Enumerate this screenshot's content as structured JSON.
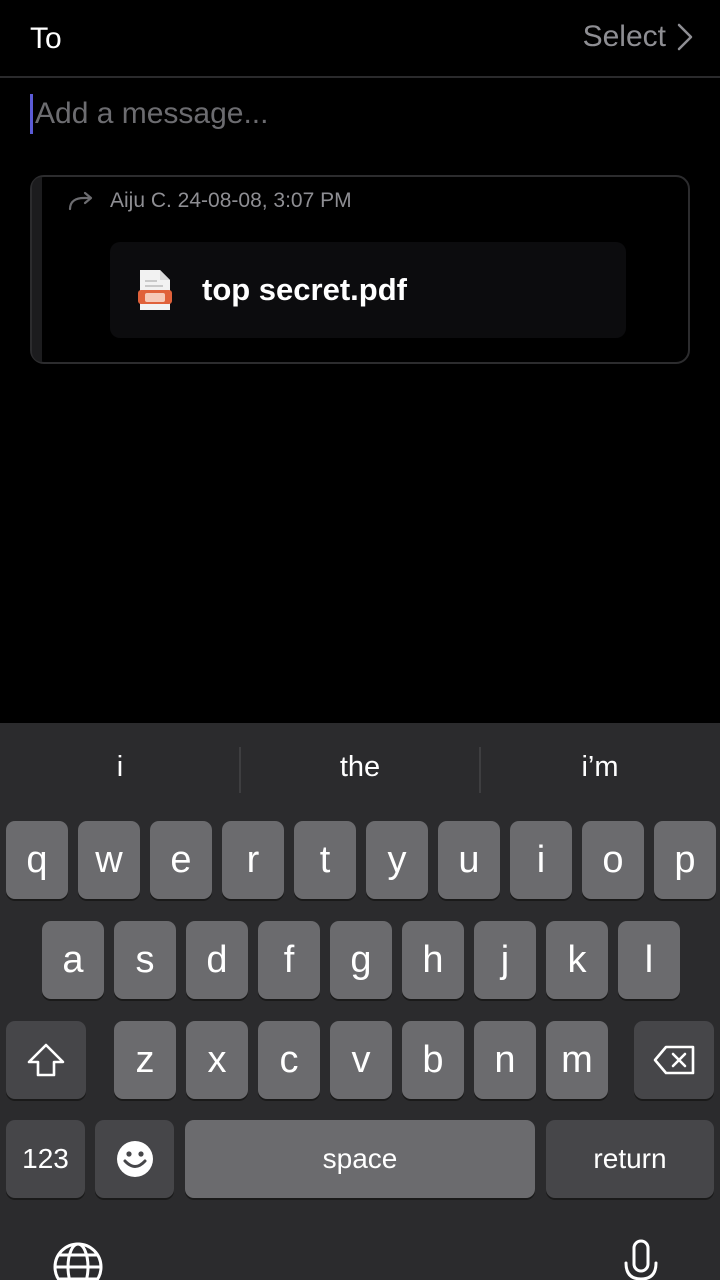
{
  "header": {
    "to_label": "To",
    "select_label": "Select"
  },
  "composer": {
    "placeholder": "Add a message..."
  },
  "forwarded": {
    "meta": "Aiju C. 24-08-08, 3:07 PM",
    "file_name": "top secret.pdf",
    "file_icon": "pdf-file-icon"
  },
  "keyboard": {
    "suggestions": [
      "i",
      "the",
      "i’m"
    ],
    "row1": [
      "q",
      "w",
      "e",
      "r",
      "t",
      "y",
      "u",
      "i",
      "o",
      "p"
    ],
    "row2": [
      "a",
      "s",
      "d",
      "f",
      "g",
      "h",
      "j",
      "k",
      "l"
    ],
    "row3": [
      "z",
      "x",
      "c",
      "v",
      "b",
      "n",
      "m"
    ],
    "numbers_label": "123",
    "space_label": "space",
    "return_label": "return",
    "shift_icon": "shift-icon",
    "delete_icon": "backspace-icon",
    "emoji_icon": "emoji-icon",
    "globe_icon": "globe-icon",
    "mic_icon": "microphone-icon"
  },
  "colors": {
    "background": "#000000",
    "keyboard_bg": "#2b2b2d",
    "key": "#6b6b6e",
    "key_dark": "#464649",
    "muted_text": "#8e8e93",
    "caret": "#5b5bd6",
    "pdf_accent": "#e0613a"
  }
}
